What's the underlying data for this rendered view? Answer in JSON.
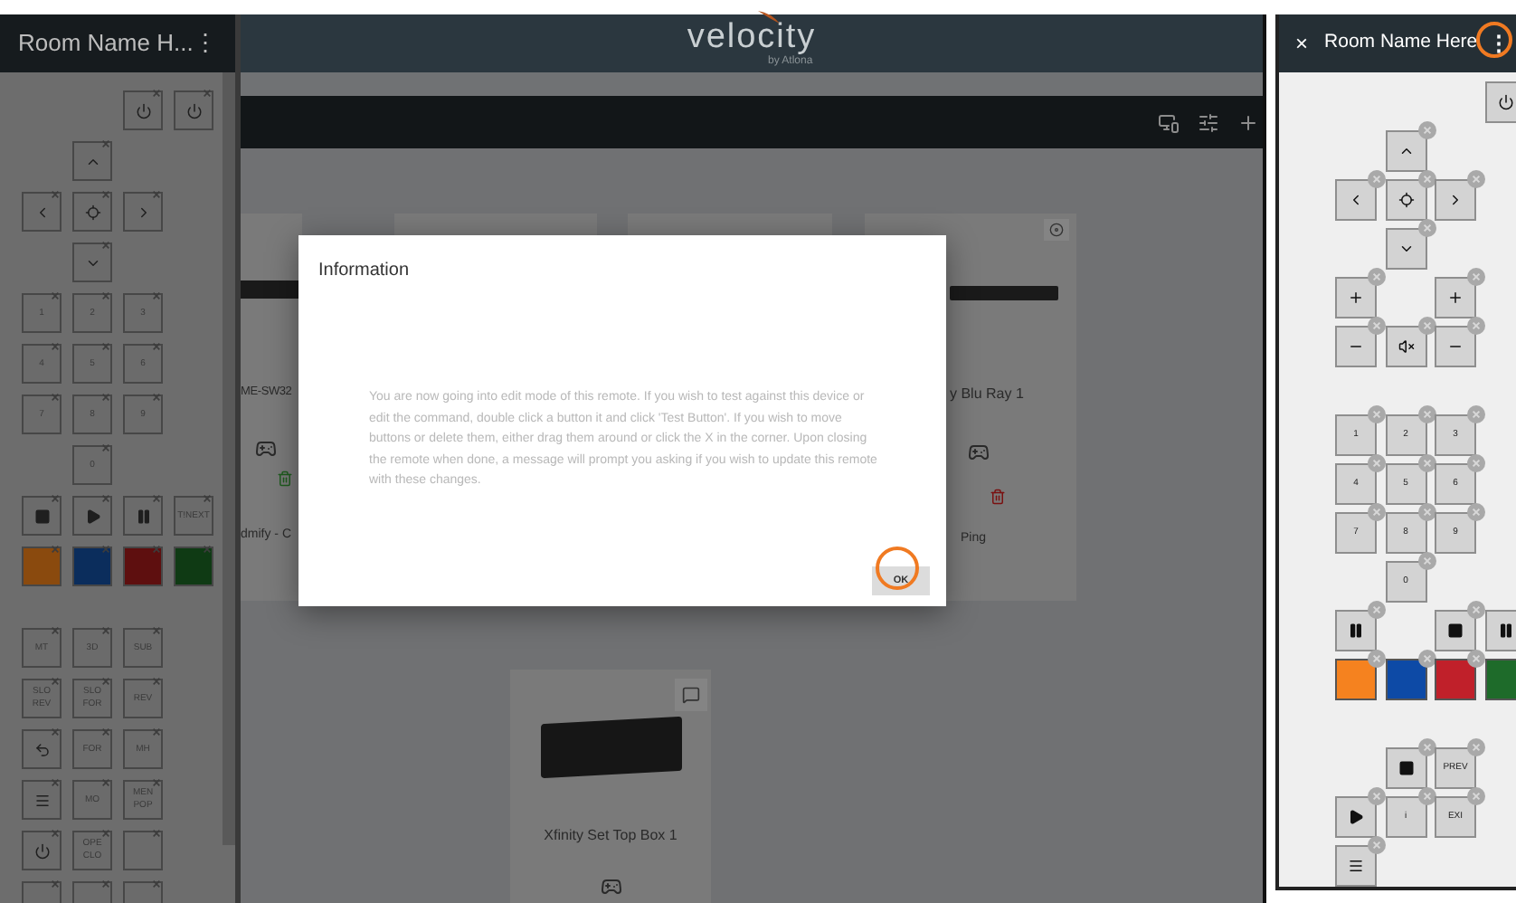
{
  "left_remote": {
    "title": "Room Name H...",
    "menu_glyph": "⋮",
    "groups": [
      [
        {
          "cells": [
            {
              "kind": "empty"
            },
            {
              "kind": "empty"
            },
            {
              "kind": "power"
            },
            {
              "kind": "power"
            }
          ]
        },
        {
          "cells": [
            {
              "kind": "empty"
            },
            {
              "kind": "up"
            },
            {
              "kind": "empty"
            },
            {
              "kind": "empty"
            }
          ]
        },
        {
          "cells": [
            {
              "kind": "left"
            },
            {
              "kind": "select"
            },
            {
              "kind": "right"
            },
            {
              "kind": "empty"
            }
          ]
        },
        {
          "cells": [
            {
              "kind": "empty"
            },
            {
              "kind": "down"
            },
            {
              "kind": "empty"
            },
            {
              "kind": "empty"
            }
          ]
        },
        {
          "cells": [
            {
              "kind": "text",
              "label": "1"
            },
            {
              "kind": "text",
              "label": "2"
            },
            {
              "kind": "text",
              "label": "3"
            },
            {
              "kind": "empty"
            }
          ]
        },
        {
          "cells": [
            {
              "kind": "text",
              "label": "4"
            },
            {
              "kind": "text",
              "label": "5"
            },
            {
              "kind": "text",
              "label": "6"
            },
            {
              "kind": "empty"
            }
          ]
        },
        {
          "cells": [
            {
              "kind": "text",
              "label": "7"
            },
            {
              "kind": "text",
              "label": "8"
            },
            {
              "kind": "text",
              "label": "9"
            },
            {
              "kind": "empty"
            }
          ]
        },
        {
          "cells": [
            {
              "kind": "empty"
            },
            {
              "kind": "text",
              "label": "0"
            },
            {
              "kind": "empty"
            },
            {
              "kind": "empty"
            }
          ]
        },
        {
          "cells": [
            {
              "kind": "stop"
            },
            {
              "kind": "play"
            },
            {
              "kind": "pause"
            },
            {
              "kind": "text",
              "label": "T!NEXT"
            }
          ]
        },
        {
          "cells": [
            {
              "kind": "swatch",
              "color": "#8a4a0e"
            },
            {
              "kind": "swatch",
              "color": "#0b2d5c"
            },
            {
              "kind": "swatch",
              "color": "#5e0f0f"
            },
            {
              "kind": "swatch",
              "color": "#0f3a14"
            }
          ]
        }
      ],
      [
        {
          "cells": [
            {
              "kind": "text",
              "label": "MT"
            },
            {
              "kind": "text",
              "label": "3D"
            },
            {
              "kind": "text",
              "label": "SUB"
            },
            {
              "kind": "empty"
            }
          ]
        },
        {
          "cells": [
            {
              "kind": "text",
              "label": "SLO REV"
            },
            {
              "kind": "text",
              "label": "SLO FOR"
            },
            {
              "kind": "text",
              "label": "REV"
            },
            {
              "kind": "empty"
            }
          ]
        },
        {
          "cells": [
            {
              "kind": "undo"
            },
            {
              "kind": "text",
              "label": "FOR"
            },
            {
              "kind": "text",
              "label": "MH"
            },
            {
              "kind": "empty"
            }
          ]
        },
        {
          "cells": [
            {
              "kind": "menu"
            },
            {
              "kind": "text",
              "label": "MO"
            },
            {
              "kind": "text",
              "label": "MEN POP"
            },
            {
              "kind": "empty"
            }
          ]
        },
        {
          "cells": [
            {
              "kind": "power"
            },
            {
              "kind": "text",
              "label": "OPE CLO"
            },
            {
              "kind": "blank"
            },
            {
              "kind": "empty"
            }
          ]
        },
        {
          "cells": [
            {
              "kind": "blank"
            },
            {
              "kind": "blank"
            },
            {
              "kind": "blank"
            },
            {
              "kind": "empty"
            }
          ]
        }
      ]
    ]
  },
  "app": {
    "logo": "velocity",
    "logo_sub": "by Atlona",
    "cards": [
      {
        "kind": "partial_left",
        "name": "ME-SW32",
        "subtitle": "dmify - C"
      },
      {
        "kind": "hidden"
      },
      {
        "kind": "hidden"
      },
      {
        "kind": "partial_right",
        "name": "y Blu Ray 1",
        "subtitle": "Ping"
      }
    ],
    "bottom_card": {
      "name": "Xfinity Set Top Box 1"
    },
    "dialog": {
      "title": "Information",
      "message": "You are now going into edit mode of this remote.  If you wish to test against this device or edit the command, double click a button it and click 'Test Button'.  If you wish to move buttons or delete them, either drag them around or click the X in the corner. Upon closing the remote when done, a message will prompt you asking if you wish to update this remote with these changes.",
      "ok": "OK"
    }
  },
  "right_remote": {
    "close_glyph": "×",
    "title": "Room Name Here",
    "menu_glyph": "⋮",
    "groups": [
      [
        {
          "cells": [
            {
              "kind": "empty"
            },
            {
              "kind": "empty"
            },
            {
              "kind": "empty"
            },
            {
              "kind": "power"
            }
          ]
        },
        {
          "cells": [
            {
              "kind": "empty"
            },
            {
              "kind": "up"
            },
            {
              "kind": "empty"
            },
            {
              "kind": "empty"
            }
          ]
        },
        {
          "cells": [
            {
              "kind": "left"
            },
            {
              "kind": "select"
            },
            {
              "kind": "right"
            },
            {
              "kind": "empty"
            }
          ]
        },
        {
          "cells": [
            {
              "kind": "empty"
            },
            {
              "kind": "down"
            },
            {
              "kind": "empty"
            },
            {
              "kind": "empty"
            }
          ]
        },
        {
          "cells": [
            {
              "kind": "plus"
            },
            {
              "kind": "empty"
            },
            {
              "kind": "plus"
            },
            {
              "kind": "empty"
            }
          ]
        },
        {
          "cells": [
            {
              "kind": "minus"
            },
            {
              "kind": "mute"
            },
            {
              "kind": "minus"
            },
            {
              "kind": "empty"
            }
          ]
        }
      ],
      [
        {
          "cells": [
            {
              "kind": "text",
              "label": "1"
            },
            {
              "kind": "text",
              "label": "2"
            },
            {
              "kind": "text",
              "label": "3"
            },
            {
              "kind": "empty"
            }
          ]
        },
        {
          "cells": [
            {
              "kind": "text",
              "label": "4"
            },
            {
              "kind": "text",
              "label": "5"
            },
            {
              "kind": "text",
              "label": "6"
            },
            {
              "kind": "empty"
            }
          ]
        },
        {
          "cells": [
            {
              "kind": "text",
              "label": "7"
            },
            {
              "kind": "text",
              "label": "8"
            },
            {
              "kind": "text",
              "label": "9"
            },
            {
              "kind": "empty"
            }
          ]
        },
        {
          "cells": [
            {
              "kind": "empty"
            },
            {
              "kind": "text",
              "label": "0"
            },
            {
              "kind": "empty"
            },
            {
              "kind": "empty"
            }
          ]
        },
        {
          "cells": [
            {
              "kind": "pause"
            },
            {
              "kind": "empty"
            },
            {
              "kind": "stop"
            },
            {
              "kind": "pause"
            }
          ]
        },
        {
          "cells": [
            {
              "kind": "swatch",
              "color": "#f5821f"
            },
            {
              "kind": "swatch",
              "color": "#0d4aa6"
            },
            {
              "kind": "swatch",
              "color": "#c0202a"
            },
            {
              "kind": "swatch",
              "color": "#1e6b2a"
            }
          ]
        }
      ],
      [
        {
          "cells": [
            {
              "kind": "empty"
            },
            {
              "kind": "stop"
            },
            {
              "kind": "text",
              "label": "PREV"
            },
            {
              "kind": "empty"
            }
          ]
        },
        {
          "cells": [
            {
              "kind": "play"
            },
            {
              "kind": "text",
              "label": "i"
            },
            {
              "kind": "text",
              "label": "EXI"
            },
            {
              "kind": "empty"
            }
          ]
        },
        {
          "cells": [
            {
              "kind": "menu"
            },
            {
              "kind": "empty"
            },
            {
              "kind": "empty"
            },
            {
              "kind": "empty"
            }
          ]
        }
      ]
    ]
  }
}
